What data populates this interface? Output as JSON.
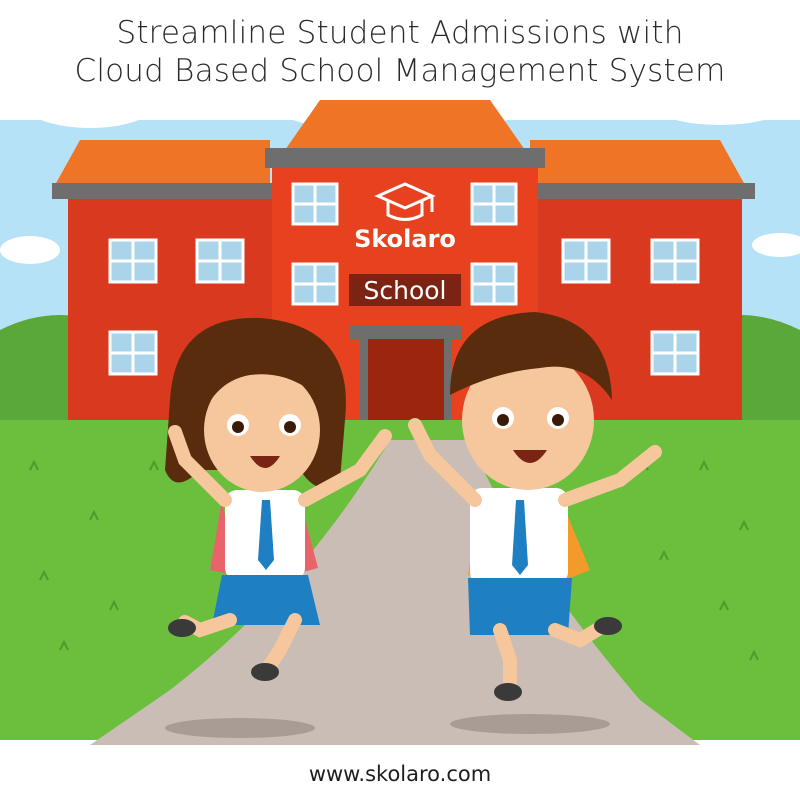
{
  "headline": {
    "line1": "Streamline Student Admissions with",
    "line2": "Cloud Based School Management System"
  },
  "brand": {
    "name": "Skolaro",
    "icon": "graduation-cap-icon"
  },
  "building": {
    "sign": "School"
  },
  "footer": {
    "url": "www.skolaro.com"
  },
  "colors": {
    "sky": "#a8dcf3",
    "roof": "#f07426",
    "wall": "#d8391f",
    "grass": "#6cbf3c",
    "path": "#c9bdb6",
    "window": "#a9d4ea"
  }
}
